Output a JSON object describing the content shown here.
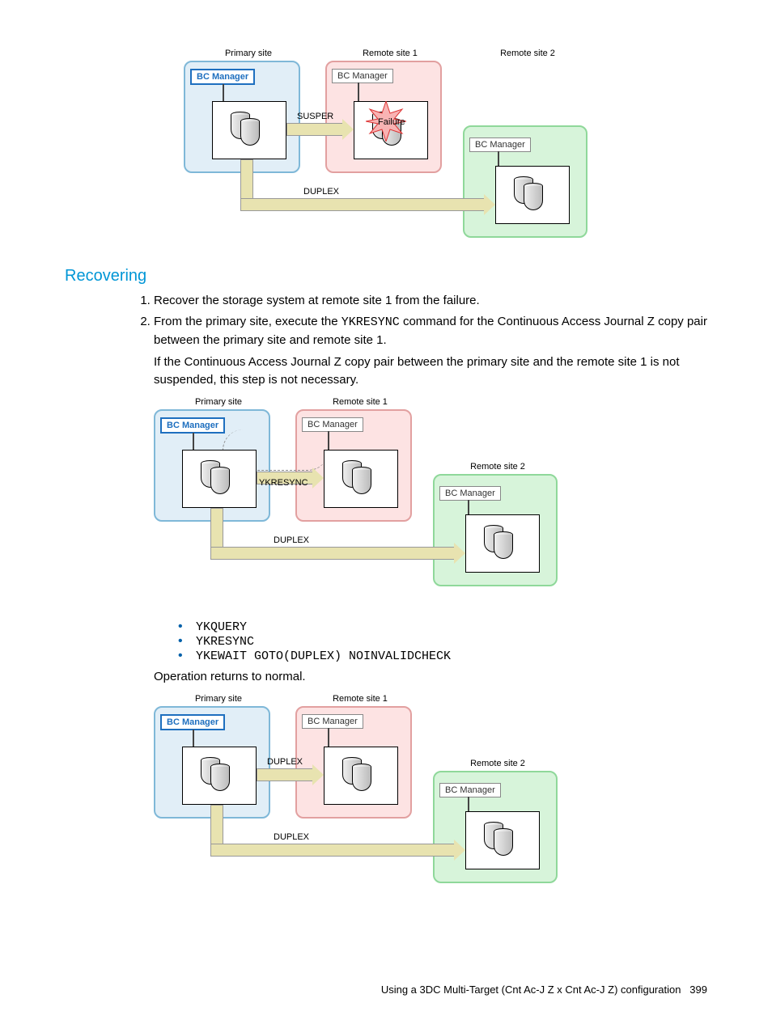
{
  "labels": {
    "primary_site": "Primary site",
    "remote_site_1": "Remote site 1",
    "remote_site_2": "Remote site 2",
    "bc_manager": "BC Manager",
    "susper": "SUSPER",
    "duplex": "DUPLEX",
    "ykresync_lbl": "YKRESYNC",
    "failure": "Failure"
  },
  "section_heading": "Recovering",
  "steps": {
    "s1": "Recover the storage system at remote site 1 from the failure.",
    "s2a": "From the primary site, execute the ",
    "s2_cmd": "YKRESYNC",
    "s2b": " command for the Continuous Access Journal Z copy pair between the primary site and remote site 1.",
    "s2_note": "If the Continuous Access Journal Z copy pair between the primary site and the remote site 1 is not suspended, this step is not necessary."
  },
  "cmds": {
    "c1": "YKQUERY",
    "c2": "YKRESYNC",
    "c3": "YKEWAIT GOTO(DUPLEX) NOINVALIDCHECK"
  },
  "returns_normal": "Operation returns to normal.",
  "footer_text": "Using a 3DC Multi-Target (Cnt Ac-J Z x Cnt Ac-J Z) configuration",
  "page_num": "399"
}
